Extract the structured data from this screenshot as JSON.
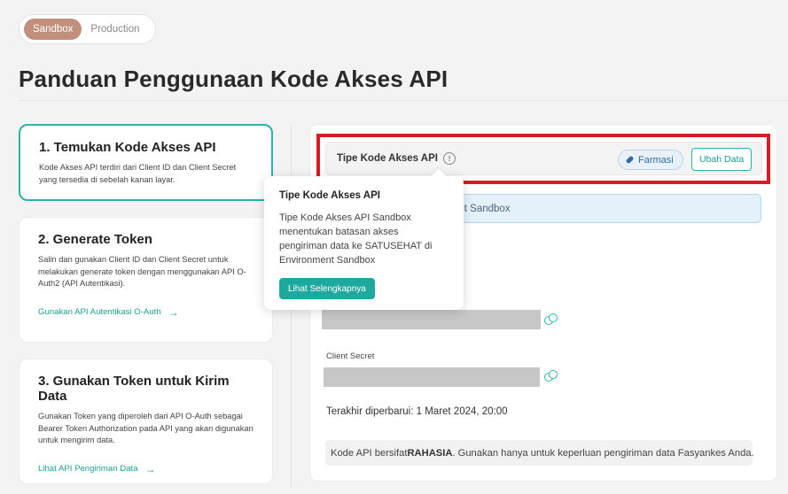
{
  "env_toggle": {
    "sandbox": "Sandbox",
    "production": "Production",
    "active": "Sandbox"
  },
  "page_title": "Panduan Penggunaan Kode Akses API",
  "steps": [
    {
      "title": "1. Temukan Kode Akses API",
      "desc": "Kode Akses API terdiri dari Client ID dan Client Secret yang tersedia di sebelah kanan layar."
    },
    {
      "title": "2. Generate Token",
      "desc": "Salin dan gunakan Client ID dan Client Secret untuk melakukan generate token dengan menggunakan API O-Auth2 (API Autentikasi).",
      "link": "Gunakan API Autentikasi O-Auth"
    },
    {
      "title": "3. Gunakan Token untuk Kirim Data",
      "desc": "Gunakan Token yang diperoleh dari API O-Auth sebagai Bearer Token Authorization pada API yang akan digunakan untuk mengirim data.",
      "link": "Lihat API Pengiriman Data"
    }
  ],
  "api_type": {
    "label": "Tipe Kode Akses API",
    "info_glyph": "!",
    "badge": "Farmasi",
    "edit_button": "Ubah Data"
  },
  "info_banner": "ent Sandbox",
  "client_secret_label": "Client Secret",
  "last_updated": "Terakhir diperbarui: 1 Maret 2024, 20:00",
  "note": {
    "prefix": "Kode API bersifat ",
    "bold": "RAHASIA",
    "suffix": ". Gunakan hanya untuk keperluan pengiriman data Fasyankes Anda."
  },
  "tooltip": {
    "title": "Tipe Kode Akses API",
    "body": "Tipe Kode Akses API Sandbox menentukan batasan akses pengiriman data ke SATUSEHAT di Environment Sandbox",
    "button": "Lihat Selengkapnya"
  },
  "icons": {
    "info": "info-icon",
    "badge": "pill-icon",
    "copy": "copy-icon",
    "arrow": "arrow-right-icon"
  },
  "colors": {
    "accent": "#2bb5a9",
    "sandbox_active": "#c28f7c",
    "highlight": "#d91c23",
    "badge": "#2e6ba5"
  }
}
